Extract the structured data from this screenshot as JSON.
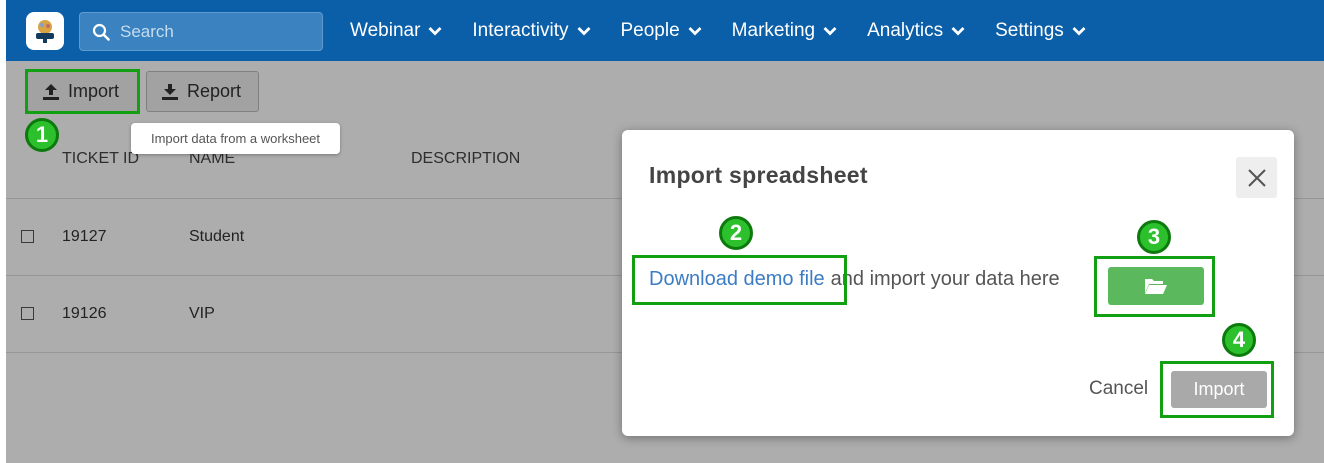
{
  "nav": {
    "search_placeholder": "Search",
    "items": [
      {
        "label": "Webinar"
      },
      {
        "label": "Interactivity"
      },
      {
        "label": "People"
      },
      {
        "label": "Marketing"
      },
      {
        "label": "Analytics"
      },
      {
        "label": "Settings"
      }
    ]
  },
  "toolbar": {
    "import_label": "Import",
    "report_label": "Report",
    "tooltip": "Import data from a worksheet"
  },
  "table": {
    "headers": [
      "TICKET ID",
      "NAME",
      "DESCRIPTION"
    ],
    "rows": [
      {
        "id": "19127",
        "name": "Student"
      },
      {
        "id": "19126",
        "name": "VIP"
      }
    ]
  },
  "modal": {
    "title": "Import spreadsheet",
    "link_text": "Download demo file",
    "instruction": "and import your data here",
    "cancel_label": "Cancel",
    "import_label": "Import"
  },
  "annotations": {
    "step1": "1",
    "step2": "2",
    "step3": "3",
    "step4": "4"
  },
  "colors": {
    "nav_bg": "#0b5ea8",
    "highlight": "#12a012",
    "folder_button": "#5cb85c",
    "link": "#3b7cc4"
  }
}
